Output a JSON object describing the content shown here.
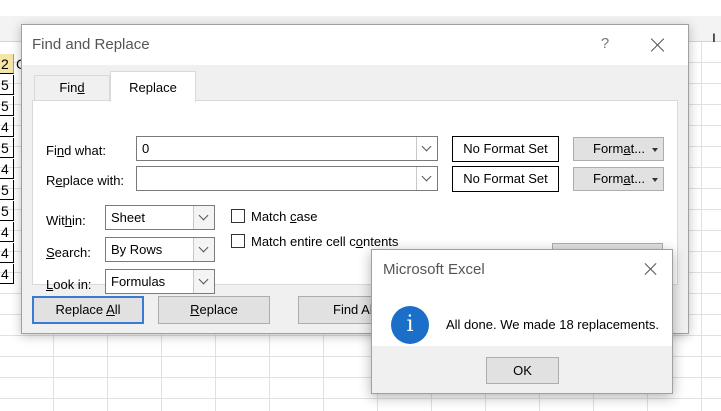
{
  "sheet": {
    "header_cells": [
      "2",
      "G"
    ],
    "column_values": [
      "5",
      "5",
      "4",
      "5",
      "4",
      "5",
      "5",
      "4",
      "4",
      "4"
    ],
    "cutoff_col_letter": "I"
  },
  "find_replace": {
    "title": "Find and Replace",
    "help": "?",
    "tabs": [
      {
        "label_pre": "Fin",
        "label_key": "d",
        "label_post": ""
      },
      {
        "label": "Replace"
      }
    ],
    "find_what_label_pre": "Fi",
    "find_what_label_key": "n",
    "find_what_label_post": "d what:",
    "find_what_value": "0",
    "replace_with_label_pre": "R",
    "replace_with_label_key": "e",
    "replace_with_label_post": "place with:",
    "replace_with_value": "",
    "no_format_label": "No Format Set",
    "format_pre": "Form",
    "format_key": "a",
    "format_post": "t...",
    "within_label_pre": "Wit",
    "within_label_key": "h",
    "within_label_post": "in:",
    "within_value": "Sheet",
    "search_label_pre": "",
    "search_label_key": "S",
    "search_label_post": "earch:",
    "search_value": "By Rows",
    "lookin_label_pre": "",
    "lookin_label_key": "L",
    "lookin_label_post": "ook in:",
    "lookin_value": "Formulas",
    "match_case_pre": "Match ",
    "match_case_key": "c",
    "match_case_post": "ase",
    "match_case_checked": false,
    "match_entire_pre": "Match entire cell c",
    "match_entire_key": "o",
    "match_entire_post": "ntents",
    "match_entire_checked": false,
    "replace_all_pre": "Replace ",
    "replace_all_key": "A",
    "replace_all_post": "ll",
    "replace_pre": "",
    "replace_key": "R",
    "replace_post": "eplace",
    "find_all_label": "Find Al"
  },
  "message_box": {
    "title": "Microsoft Excel",
    "message": "All done. We made 18 replacements.",
    "icon": "info-icon",
    "ok_label": "OK"
  },
  "colors": {
    "accent_border": "#3a7ad6",
    "info_icon": "#1b6fc8",
    "header_cell": "#f5e6a8"
  }
}
